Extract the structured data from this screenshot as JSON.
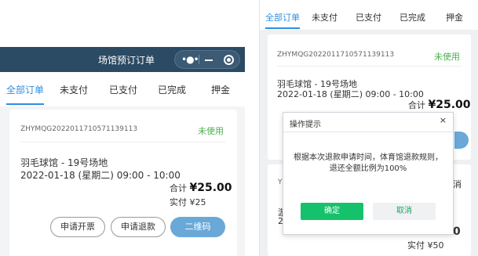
{
  "left": {
    "window_title": "场馆预订订单",
    "tabs": [
      {
        "label": "全部订单"
      },
      {
        "label": "未支付"
      },
      {
        "label": "已支付"
      },
      {
        "label": "已完成"
      },
      {
        "label": "押金"
      }
    ],
    "order": {
      "order_no": "ZHYMQG2022011710571139113",
      "status": "未使用",
      "venue": "羽毛球馆 - 19号场地",
      "time": "2022-01-18 (星期二) 09:00 - 10:00",
      "total_label": "合计",
      "total_value": "¥25.00",
      "paid": "实付 ¥25",
      "buttons": {
        "invoice": "申请开票",
        "refund": "申请退款",
        "qrcode": "二维码"
      }
    }
  },
  "right": {
    "tabs": [
      {
        "label": "全部订单"
      },
      {
        "label": "未支付"
      },
      {
        "label": "已支付"
      },
      {
        "label": "已完成"
      },
      {
        "label": "押金"
      }
    ],
    "order": {
      "order_no": "ZHYMQG2022011710571139113",
      "status": "未使用",
      "venue": "羽毛球馆 - 19号场地",
      "time": "2022-01-18 (星期二) 09:00 - 10:00",
      "total_label": "合计",
      "total_value": "¥25.00"
    },
    "second_order": {
      "no_fragment": "YI",
      "status_fragment": "消",
      "venue_fragment": "游",
      "time_fragment": "20",
      "total_fragment": "0",
      "paid": "实付 ¥50"
    },
    "dialog": {
      "title": "操作提示",
      "close": "×",
      "message_line1": "根据本次退款申请时间，体育馆退款规则，",
      "message_line2": "退还全额比例为100%",
      "confirm": "确定",
      "cancel": "取消"
    }
  }
}
